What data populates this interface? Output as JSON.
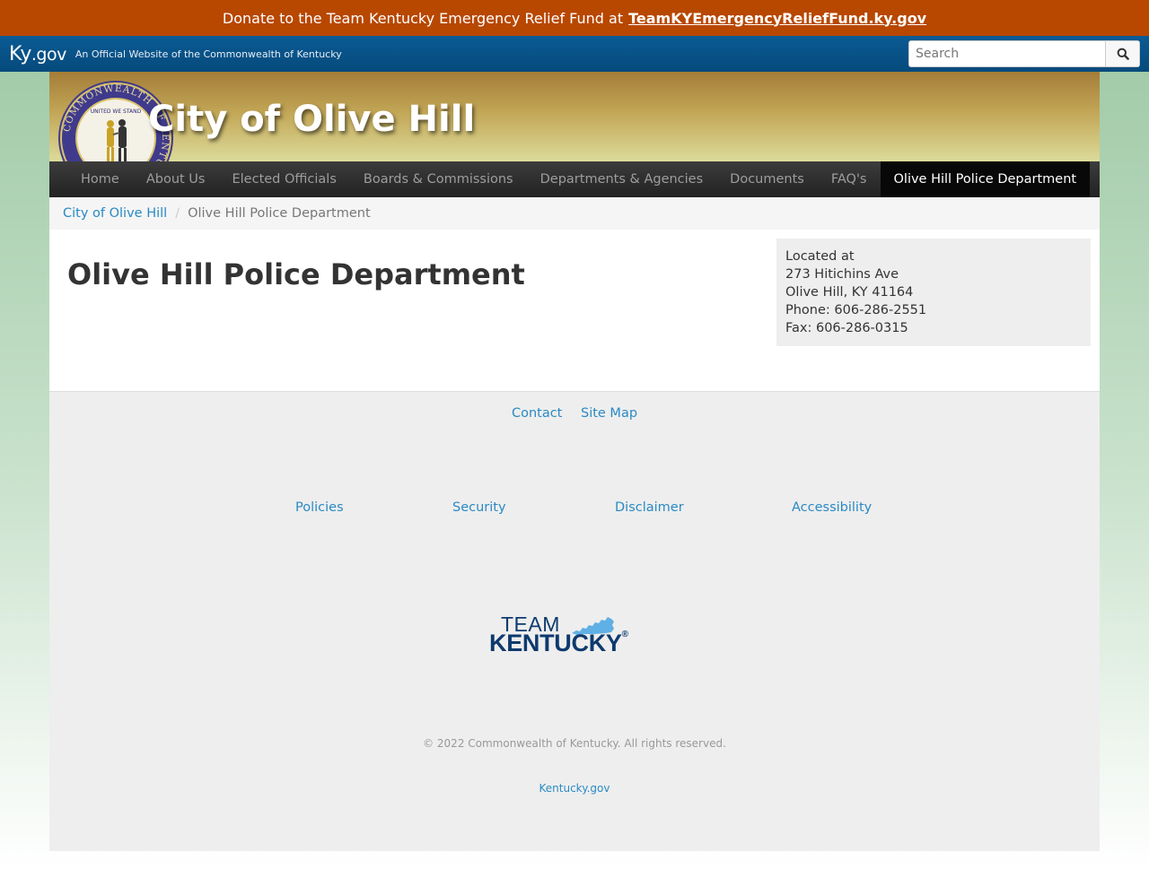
{
  "donate": {
    "text": "Donate to the Team Kentucky Emergency Relief Fund at",
    "link": "TeamKYEmergencyReliefFund.ky.gov"
  },
  "kygov": {
    "logo_ky": "Ky",
    "logo_gov": ".gov",
    "tagline": "An Official Website of the Commonwealth of Kentucky",
    "search_placeholder": "Search"
  },
  "site": {
    "title": "City of Olive Hill",
    "seal_top_text": "COMMONWEALTH OF KENTUCKY",
    "seal_motto": "UNITED WE STAND"
  },
  "nav": {
    "items": [
      {
        "label": "Home"
      },
      {
        "label": "About Us"
      },
      {
        "label": "Elected Officials"
      },
      {
        "label": "Boards & Commissions"
      },
      {
        "label": "Departments & Agencies"
      },
      {
        "label": "Documents"
      },
      {
        "label": "FAQ's"
      },
      {
        "label": "Olive Hill Police Department",
        "active": true
      }
    ]
  },
  "breadcrumb": {
    "home": "City of Olive Hill",
    "separator": "/",
    "current": "Olive Hill Police Department"
  },
  "main": {
    "heading": "Olive Hill Police Department"
  },
  "info": {
    "located": "Located at",
    "street": "273 Hitichins Ave",
    "city": "Olive Hill, KY 41164",
    "phone": "Phone:  606-286-2551",
    "fax": "Fax:  606-286-0315"
  },
  "footer": {
    "contact": "Contact",
    "sitemap": "Site Map",
    "policies": "Policies",
    "security": "Security",
    "disclaimer": "Disclaimer",
    "accessibility": "Accessibility",
    "team_word1": "TEAM",
    "team_word2": "KENTUCKY",
    "team_reg": "®",
    "copyright": "© 2022 Commonwealth of Kentucky. All rights reserved.",
    "kygov": "Kentucky.gov"
  },
  "colors": {
    "donate_bar": "#b84700",
    "kygov_bar": "#064a7c",
    "link": "#2a8ac4",
    "team_kentucky_navy": "#0d3a6e",
    "team_kentucky_map": "#5fb0e4"
  }
}
